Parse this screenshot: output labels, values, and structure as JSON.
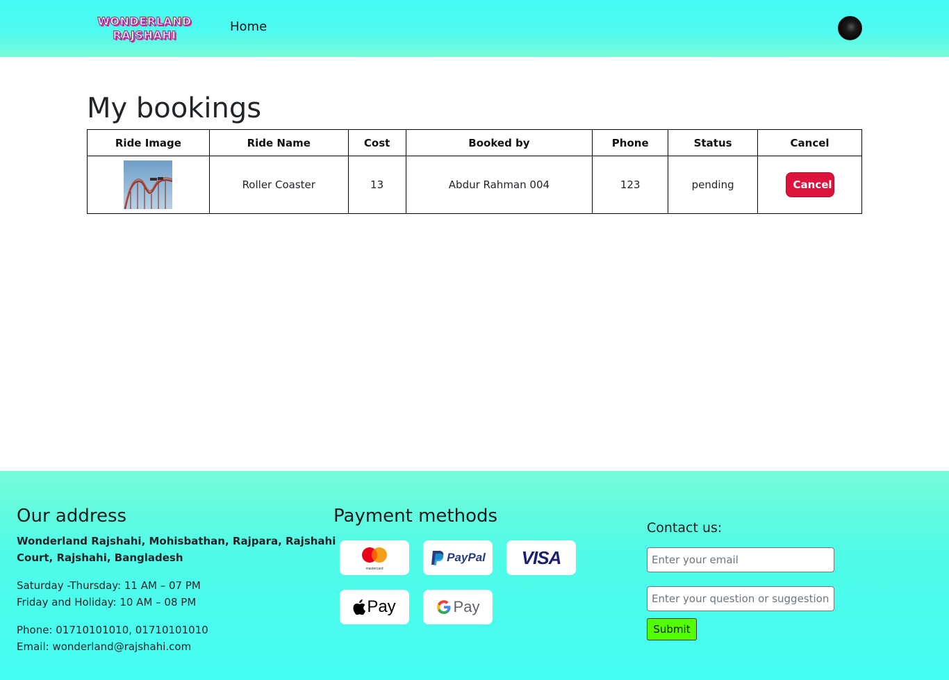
{
  "header": {
    "logo_line1": "WONDERLAND",
    "logo_line2": "RAJSHAHI",
    "nav_home": "Home"
  },
  "main": {
    "title": "My bookings",
    "table": {
      "columns": [
        "Ride Image",
        "Ride Name",
        "Cost",
        "Booked by",
        "Phone",
        "Status",
        "Cancel"
      ],
      "rows": [
        {
          "ride_name": "Roller Coaster",
          "cost": "13",
          "booked_by": "Abdur Rahman 004",
          "phone": "123",
          "status": "pending",
          "cancel_label": "Cancel"
        }
      ]
    }
  },
  "footer": {
    "address": {
      "heading": "Our address",
      "line1": "Wonderland Rajshahi, Mohisbathan, Rajpara, Rajshahi",
      "line2": "Court, Rajshahi, Bangladesh",
      "hours1": "Saturday -Thursday: 11 AM – 07 PM",
      "hours2": "Friday and Holiday: 10 AM – 08 PM",
      "phone": "Phone: 01710101010, 01710101010",
      "email": "Email: wonderland@rajshahi.com"
    },
    "payment": {
      "heading": "Payment methods",
      "mastercard_label": "mastercard",
      "paypal_label": "PayPal",
      "visa_label": "VISA",
      "applepay_label": "Pay",
      "gpay_label": "Pay"
    },
    "contact": {
      "heading": "Contact us:",
      "email_placeholder": "Enter your email",
      "question_placeholder": "Enter your question or suggestion",
      "submit_label": "Submit"
    }
  }
}
